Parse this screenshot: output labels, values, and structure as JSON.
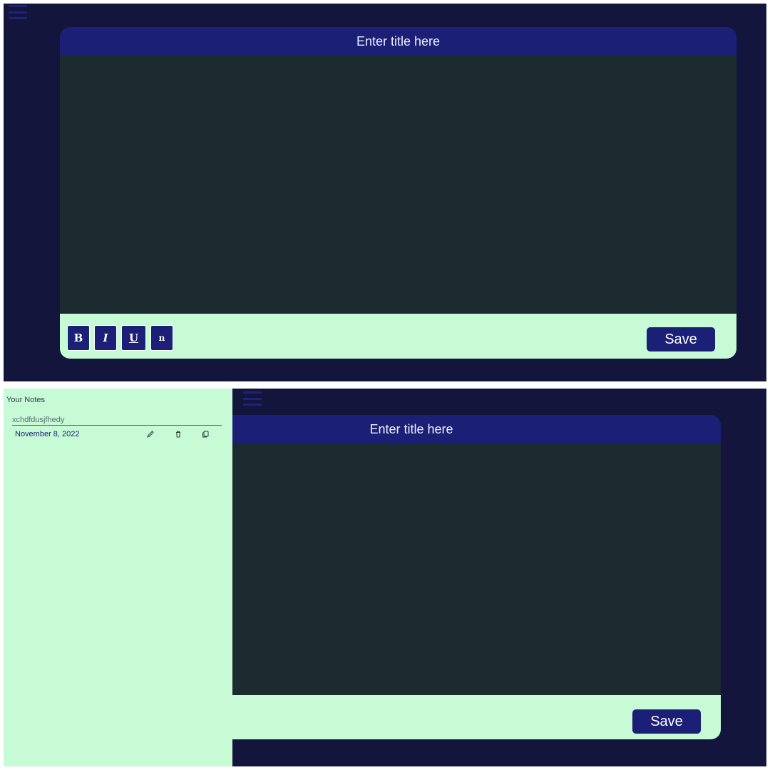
{
  "editor": {
    "title_placeholder": "Enter title here",
    "format_buttons": {
      "bold": "B",
      "italic": "I",
      "underline": "U",
      "normal": "n"
    },
    "save_label": "Save"
  },
  "sidebar": {
    "heading": "Your Notes",
    "notes": [
      {
        "title": "xchdfdusjfhedy",
        "date": "November 8, 2022"
      }
    ]
  },
  "icons": {
    "menu": "hamburger-menu-icon",
    "edit": "pencil-icon",
    "delete": "trash-icon",
    "copy": "copy-icon"
  },
  "colors": {
    "app_background": "#13153d",
    "title_bar": "#1b1f75",
    "editor_body": "#1b2b30",
    "toolbar_and_sidebar": "#c6fbd6",
    "button": "#1b1f75",
    "text_light": "#eef0ff"
  }
}
